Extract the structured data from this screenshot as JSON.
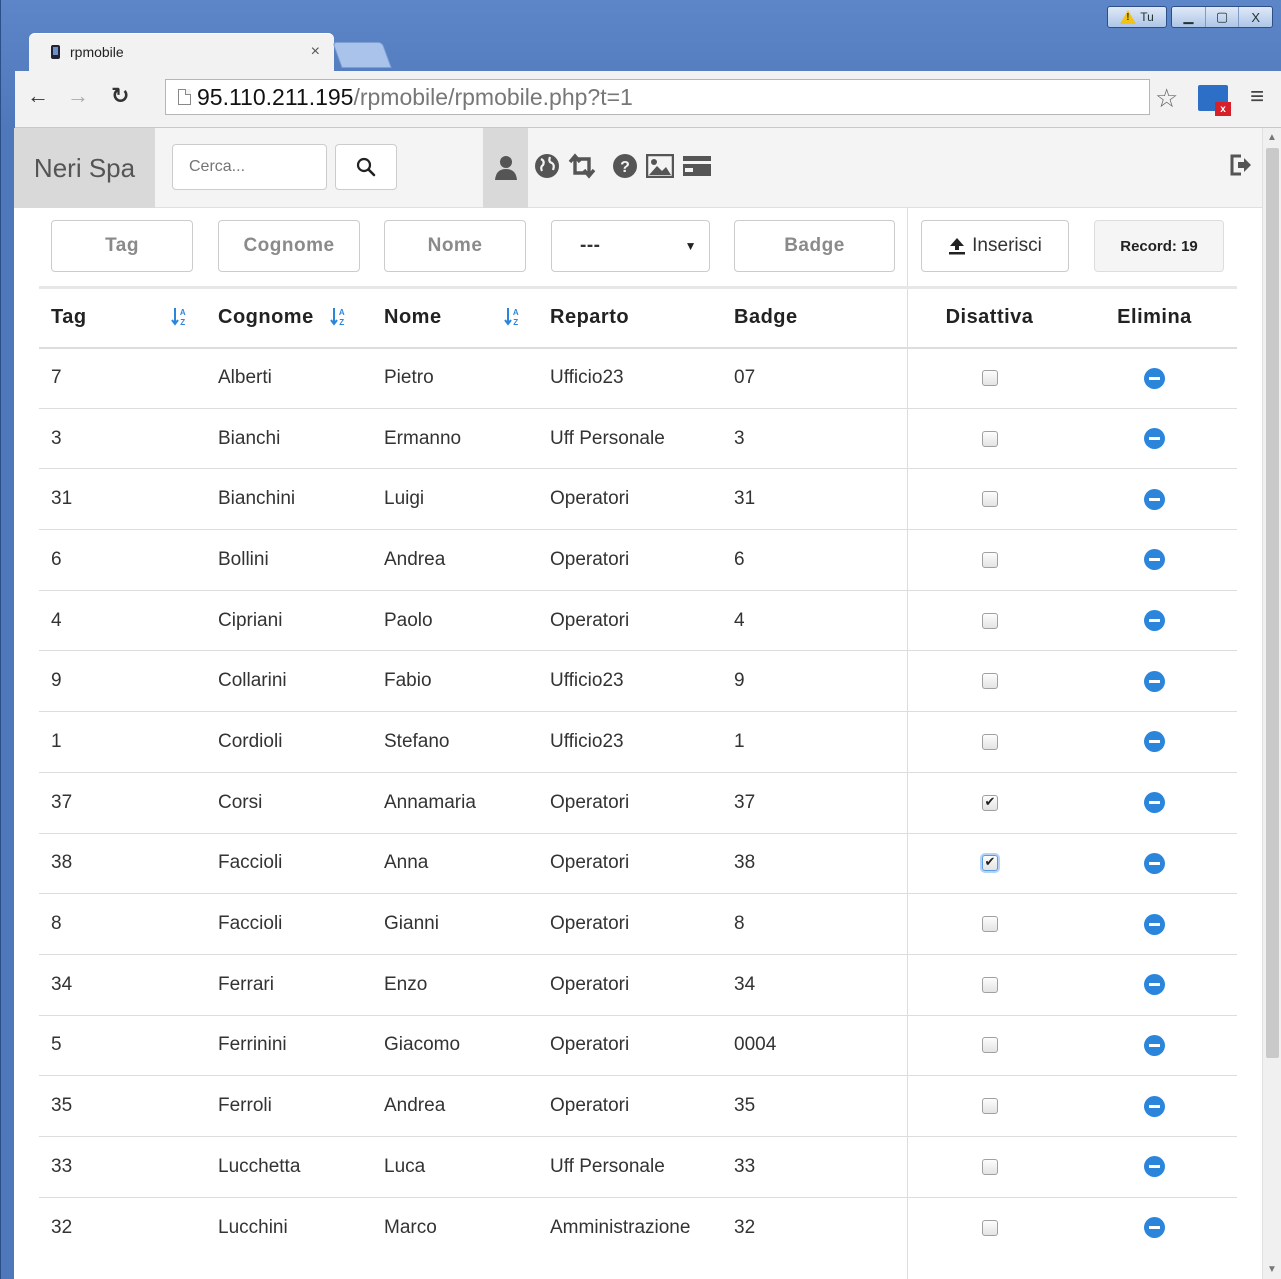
{
  "window": {
    "warning_label": "Tu",
    "minimize_icon": "minimize-icon",
    "maximize_icon": "maximize-icon",
    "close_label": "X"
  },
  "tab": {
    "title": "rpmobile",
    "close": "×"
  },
  "omnibox": {
    "host": "95.110.211.195",
    "path": "/rpmobile/rpmobile.php?t=1"
  },
  "navbar": {
    "brand": "Neri Spa",
    "search_placeholder": "Cerca...",
    "icons": [
      "user-icon",
      "globe-icon",
      "retweet-icon",
      "question-icon",
      "image-icon",
      "credit-card-icon",
      "logout-icon"
    ]
  },
  "filters": {
    "tag": "Tag",
    "cognome": "Cognome",
    "nome": "Nome",
    "reparto": "---",
    "badge": "Badge",
    "insert_label": "Inserisci",
    "record_label": "Record: 19"
  },
  "table": {
    "headers": {
      "tag": "Tag",
      "cognome": "Cognome",
      "nome": "Nome",
      "reparto": "Reparto",
      "badge": "Badge",
      "disattiva": "Disattiva",
      "elimina": "Elimina"
    },
    "rows": [
      {
        "tag": "7",
        "cognome": "Alberti",
        "nome": "Pietro",
        "reparto": "Ufficio23",
        "badge": "07",
        "disattiva": false
      },
      {
        "tag": "3",
        "cognome": "Bianchi",
        "nome": "Ermanno",
        "reparto": "Uff Personale",
        "badge": "3",
        "disattiva": false
      },
      {
        "tag": "31",
        "cognome": "Bianchini",
        "nome": "Luigi",
        "reparto": "Operatori",
        "badge": "31",
        "disattiva": false
      },
      {
        "tag": "6",
        "cognome": "Bollini",
        "nome": "Andrea",
        "reparto": "Operatori",
        "badge": "6",
        "disattiva": false
      },
      {
        "tag": "4",
        "cognome": "Cipriani",
        "nome": "Paolo",
        "reparto": "Operatori",
        "badge": "4",
        "disattiva": false
      },
      {
        "tag": "9",
        "cognome": "Collarini",
        "nome": "Fabio",
        "reparto": "Ufficio23",
        "badge": "9",
        "disattiva": false
      },
      {
        "tag": "1",
        "cognome": "Cordioli",
        "nome": "Stefano",
        "reparto": "Ufficio23",
        "badge": "1",
        "disattiva": false
      },
      {
        "tag": "37",
        "cognome": "Corsi",
        "nome": "Annamaria",
        "reparto": "Operatori",
        "badge": "37",
        "disattiva": true
      },
      {
        "tag": "38",
        "cognome": "Faccioli",
        "nome": "Anna",
        "reparto": "Operatori",
        "badge": "38",
        "disattiva": true,
        "focused": true
      },
      {
        "tag": "8",
        "cognome": "Faccioli",
        "nome": "Gianni",
        "reparto": "Operatori",
        "badge": "8",
        "disattiva": false
      },
      {
        "tag": "34",
        "cognome": "Ferrari",
        "nome": "Enzo",
        "reparto": "Operatori",
        "badge": "34",
        "disattiva": false
      },
      {
        "tag": "5",
        "cognome": "Ferrinini",
        "nome": "Giacomo",
        "reparto": "Operatori",
        "badge": "0004",
        "disattiva": false
      },
      {
        "tag": "35",
        "cognome": "Ferroli",
        "nome": "Andrea",
        "reparto": "Operatori",
        "badge": "35",
        "disattiva": false
      },
      {
        "tag": "33",
        "cognome": "Lucchetta",
        "nome": "Luca",
        "reparto": "Uff Personale",
        "badge": "33",
        "disattiva": false
      },
      {
        "tag": "32",
        "cognome": "Lucchini",
        "nome": "Marco",
        "reparto": "Amministrazione",
        "badge": "32",
        "disattiva": false
      }
    ]
  },
  "colors": {
    "accent": "#2b86db",
    "brand_bg": "#d9d9d9",
    "window_frame": "#4f78bb"
  }
}
